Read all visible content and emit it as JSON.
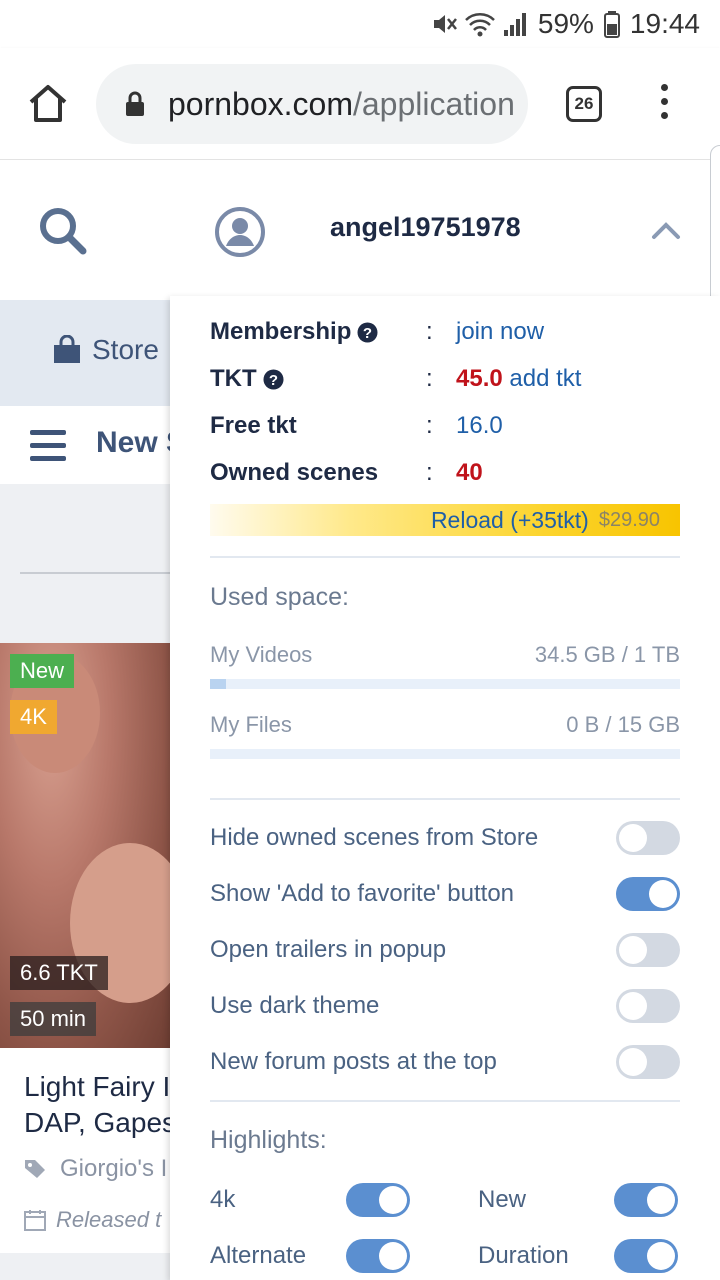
{
  "status_bar": {
    "battery": "59%",
    "time": "19:44"
  },
  "browser": {
    "url_domain": "pornbox.com",
    "url_path": "/application",
    "tab_count": "26"
  },
  "header": {
    "username": "angel19751978"
  },
  "store_bar": {
    "store_label": "Store"
  },
  "nav_bar": {
    "title": "New S"
  },
  "card": {
    "badge_new": "New",
    "badge_4k": "4K",
    "price": "6.6 TKT",
    "duration": "50 min",
    "title_line1": "Light Fairy I",
    "title_line2": "DAP, Gapes",
    "studio": "Giorgio's I",
    "released": "Released t"
  },
  "account": {
    "membership_label": "Membership",
    "membership_value": "join now",
    "tkt_label": "TKT",
    "tkt_value": "45.0",
    "tkt_link": "add tkt",
    "free_tkt_label": "Free tkt",
    "free_tkt_value": "16.0",
    "owned_label": "Owned scenes",
    "owned_value": "40",
    "colon": ":",
    "reload_label": "Reload (+35tkt)",
    "reload_price": "$29.90"
  },
  "storage": {
    "title": "Used space:",
    "videos_label": "My Videos",
    "videos_value": "34.5 GB / 1 TB",
    "videos_fraction": 0.0345,
    "files_label": "My Files",
    "files_value": "0 B / 15 GB",
    "files_fraction": 0
  },
  "settings": [
    {
      "label": "Hide owned scenes from Store",
      "on": false
    },
    {
      "label": "Show 'Add to favorite' button",
      "on": true
    },
    {
      "label": "Open trailers in popup",
      "on": false
    },
    {
      "label": "Use dark theme",
      "on": false
    },
    {
      "label": "New forum posts at the top",
      "on": false
    }
  ],
  "highlights": {
    "title": "Highlights:",
    "items": [
      {
        "label": "4k",
        "on": true
      },
      {
        "label": "New",
        "on": true
      },
      {
        "label": "Alternate",
        "on": true
      },
      {
        "label": "Duration",
        "on": true
      }
    ]
  },
  "colors": {
    "accent_blue": "#5b8fd0",
    "red": "#c0131b",
    "link": "#1f5fa8"
  }
}
